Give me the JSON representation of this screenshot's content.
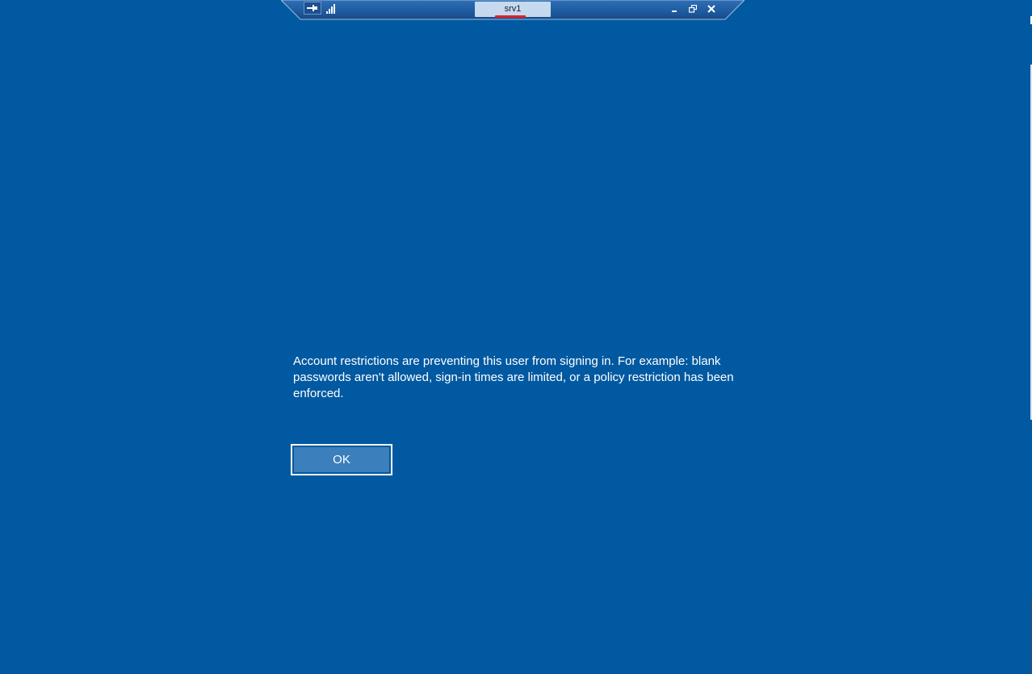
{
  "connection_bar": {
    "title": "srv1",
    "pin_icon": "pin-icon",
    "signal_icon": "connection-signal-icon",
    "buttons": {
      "minimize_icon": "minimize-icon",
      "restore_icon": "restore-icon",
      "close_icon": "close-icon"
    }
  },
  "dialog": {
    "message": "Account restrictions are preventing this user from signing in. For example: blank passwords aren't allowed, sign-in times are limited, or a policy restriction has been enforced.",
    "ok_label": "OK"
  },
  "colors": {
    "background": "#0159a1",
    "button_fill": "#3b7fbd",
    "title_underline": "#e0212b"
  }
}
